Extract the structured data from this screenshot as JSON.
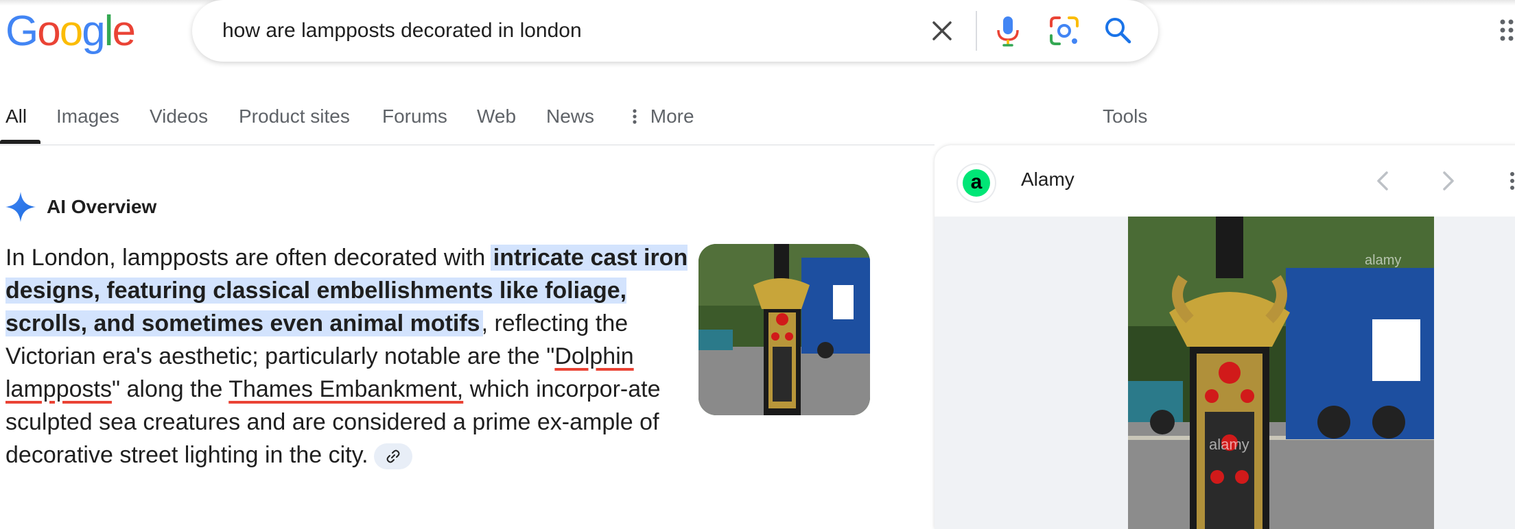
{
  "brand": {
    "logo_letters": [
      "G",
      "o",
      "o",
      "g",
      "l",
      "e"
    ],
    "logo_colors": [
      "#4285f4",
      "#ea4335",
      "#fbbc05",
      "#4285f4",
      "#34a853",
      "#ea4335"
    ]
  },
  "search": {
    "query": "how are lampposts decorated in london",
    "clear_icon": "close-icon",
    "voice_icon": "mic-icon",
    "lens_icon": "lens-icon",
    "search_icon": "search-icon"
  },
  "tabs": [
    {
      "label": "All",
      "active": true
    },
    {
      "label": "Images"
    },
    {
      "label": "Videos"
    },
    {
      "label": "Product sites"
    },
    {
      "label": "Forums"
    },
    {
      "label": "Web"
    },
    {
      "label": "News"
    },
    {
      "label": "More"
    }
  ],
  "tools_label": "Tools",
  "ai_overview": {
    "title": "AI Overview",
    "text_1": "In London, lampposts are often decorated with ",
    "highlight": "intricate cast iron designs, featuring classical embellishments like foliage, scrolls, and sometimes even animal motifs",
    "text_2": ", reflecting the Victorian era's aesthetic; particularly notable are the \"",
    "link_1": "Dolphin lampposts",
    "text_3": "\" along the ",
    "link_2": "Thames Embankment,",
    "text_4": " which incorpor-ate sculpted sea creatures and are considered a prime ex-ample of decorative street lighting in the city."
  },
  "side_panel": {
    "source_initial": "a",
    "source_name": "Alamy",
    "watermark": "alamy"
  },
  "colors": {
    "accent_blue": "#1a73e8",
    "highlight_bg": "#d3e3fd",
    "underline_red": "#ea4335"
  }
}
